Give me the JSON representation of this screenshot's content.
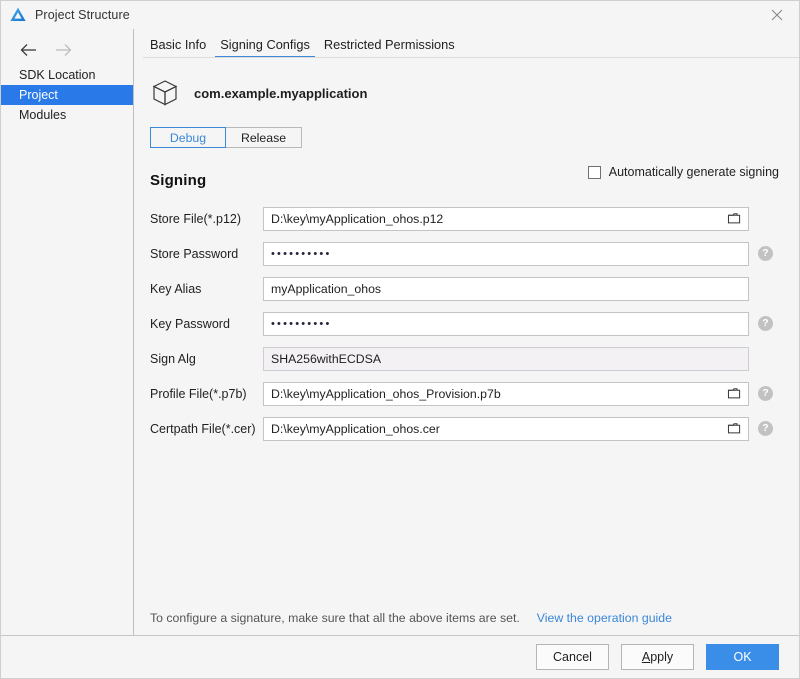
{
  "window": {
    "title": "Project Structure",
    "app_icon": "deveco-logo-icon",
    "close_icon": "close-icon"
  },
  "sidebar": {
    "back_icon": "arrow-left-icon",
    "forward_icon": "arrow-right-icon",
    "items": [
      {
        "label": "SDK Location",
        "selected": false
      },
      {
        "label": "Project",
        "selected": true
      },
      {
        "label": "Modules",
        "selected": false
      }
    ]
  },
  "tabs": [
    {
      "label": "Basic Info",
      "active": false
    },
    {
      "label": "Signing Configs",
      "active": true
    },
    {
      "label": "Restricted Permissions",
      "active": false
    }
  ],
  "package": {
    "icon": "package-cube-icon",
    "name": "com.example.myapplication"
  },
  "build_variants": [
    {
      "label": "Debug",
      "active": true
    },
    {
      "label": "Release",
      "active": false
    }
  ],
  "auto_generate": {
    "label": "Automatically generate signing",
    "checked": false
  },
  "section": {
    "title": "Signing"
  },
  "fields": [
    {
      "label": "Store File(*.p12)",
      "value": "D:\\key\\myApplication_ohos.p12",
      "type": "text",
      "has_browse": true,
      "has_help": false,
      "readonly": false
    },
    {
      "label": "Store Password",
      "value": "••••••••••",
      "type": "password",
      "has_browse": false,
      "has_help": true,
      "readonly": false
    },
    {
      "label": "Key Alias",
      "value": "myApplication_ohos",
      "type": "text",
      "has_browse": false,
      "has_help": false,
      "readonly": false
    },
    {
      "label": "Key Password",
      "value": "••••••••••",
      "type": "password",
      "has_browse": false,
      "has_help": true,
      "readonly": false
    },
    {
      "label": "Sign Alg",
      "value": "SHA256withECDSA",
      "type": "text",
      "has_browse": false,
      "has_help": false,
      "readonly": true
    },
    {
      "label": "Profile File(*.p7b)",
      "value": "D:\\key\\myApplication_ohos_Provision.p7b",
      "type": "text",
      "has_browse": true,
      "has_help": true,
      "readonly": false
    },
    {
      "label": "Certpath File(*.cer)",
      "value": "D:\\key\\myApplication_ohos.cer",
      "type": "text",
      "has_browse": true,
      "has_help": true,
      "readonly": false
    }
  ],
  "hint": {
    "text": "To configure a signature, make sure that all the above items are set.",
    "link": "View the operation guide"
  },
  "footer": {
    "cancel": "Cancel",
    "apply_mnemonic": "A",
    "apply_rest": "pply",
    "ok": "OK"
  },
  "colors": {
    "accent_blue": "#2979e8",
    "tab_blue": "#3b87d8",
    "primary_button": "#3b8ee8",
    "help_gray": "#c2c2c2",
    "window_bg": "#f5f5f5"
  },
  "icons": {
    "browse": "folder-icon",
    "help": "?"
  }
}
